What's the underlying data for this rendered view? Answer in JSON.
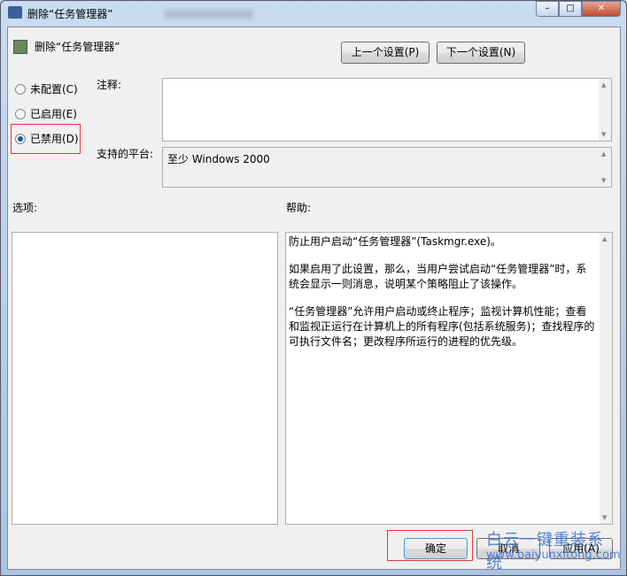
{
  "window": {
    "title": "删除“任务管理器”",
    "minimize": "–",
    "maximize": "□",
    "close": "✕"
  },
  "header": {
    "title": "删除“任务管理器”",
    "prev": "上一个设置(P)",
    "next": "下一个设置(N)"
  },
  "radios": [
    {
      "label": "未配置(C)",
      "checked": false
    },
    {
      "label": "已启用(E)",
      "checked": false
    },
    {
      "label": "已禁用(D)",
      "checked": true
    }
  ],
  "comment_label": "注释:",
  "platform_label": "支持的平台:",
  "platform_value": "至少 Windows 2000",
  "options_label": "选项:",
  "help_label": "帮助:",
  "help": [
    "防止用户启动“任务管理器”(Taskmgr.exe)。",
    "如果启用了此设置，那么，当用户尝试启动“任务管理器”时，系统会显示一则消息，说明某个策略阻止了该操作。",
    "“任务管理器”允许用户启动或终止程序；监视计算机性能；查看和监视正运行在计算机上的所有程序(包括系统服务)；查找程序的可执行文件名；更改程序所运行的进程的优先级。"
  ],
  "footer": {
    "ok": "确定",
    "cancel": "取消",
    "apply": "应用(A)"
  },
  "watermark": {
    "title": "白云一键重装系统",
    "url": "www.baiyunxitong.com"
  },
  "colors": {
    "highlight": "#e0393e"
  }
}
